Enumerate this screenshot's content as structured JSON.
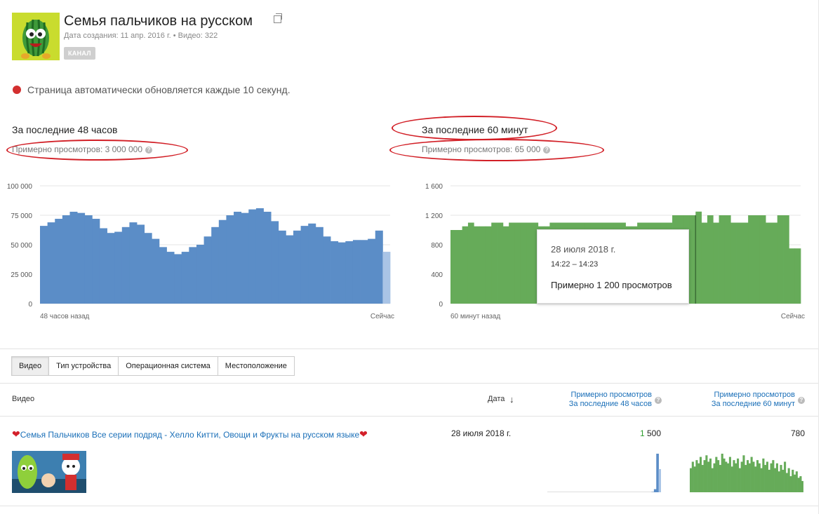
{
  "channel": {
    "title": "Семья пальчиков на русском",
    "meta": "Дата создания: 11 апр. 2016 г.  •  Видео: 322",
    "badge": "КАНАЛ"
  },
  "live_notice": "Страница автоматически обновляется каждые 10 секунд.",
  "sections": {
    "left": {
      "title": "За последние 48 часов",
      "views": "Примерно просмотров: 3 000 000",
      "start_label": "48 часов назад",
      "end_label": "Сейчас"
    },
    "right": {
      "title": "За последние 60 минут",
      "views": "Примерно просмотров: 65 000",
      "start_label": "60 минут назад",
      "end_label": "Сейчас"
    }
  },
  "tooltip": {
    "date": "28 июля 2018 г.",
    "time": "14:22 – 14:23",
    "views": "Примерно 1 200 просмотров"
  },
  "tabs": [
    "Видео",
    "Тип устройства",
    "Операционная система",
    "Местоположение"
  ],
  "table": {
    "headers": {
      "video": "Видео",
      "date": "Дата",
      "views48_line1": "Примерно просмотров",
      "views48_line2": "За последние 48 часов",
      "views60_line1": "Примерно просмотров",
      "views60_line2": "За последние 60 минут"
    },
    "rows": [
      {
        "title": "Семья Пальчиков Все серии подряд - Хелло Китти, Овощи и Фрукты на русском языке",
        "date": "28 июля 2018 г.",
        "views48_a": "1",
        "views48_b": " 500",
        "views60": "780"
      }
    ]
  },
  "colors": {
    "blue_bars": "#5b8dc7",
    "green_bars": "#66ab59",
    "annotation_red": "#d21f26",
    "link_blue": "#1a6fb8"
  },
  "chart_data": [
    {
      "type": "bar",
      "title": "За последние 48 часов",
      "ylim": [
        0,
        100000
      ],
      "yticks": [
        "100 000",
        "75 000",
        "50 000",
        "25 000",
        "0"
      ],
      "x_start_label": "48 часов назад",
      "x_end_label": "Сейчас",
      "values": [
        66000,
        69000,
        72000,
        75000,
        78000,
        77000,
        75000,
        72000,
        64000,
        60000,
        61000,
        65000,
        69000,
        67000,
        60000,
        55000,
        48000,
        44000,
        42000,
        44000,
        48000,
        50000,
        57000,
        65000,
        71000,
        75000,
        78000,
        77000,
        80000,
        81000,
        78000,
        70000,
        62000,
        58000,
        62000,
        66000,
        68000,
        65000,
        57000,
        53000,
        52000,
        53000,
        54000,
        54000,
        55000,
        62000,
        44000
      ]
    },
    {
      "type": "bar",
      "title": "За последние 60 минут",
      "ylim": [
        0,
        1600
      ],
      "yticks": [
        "1 600",
        "1 200",
        "800",
        "400",
        "0"
      ],
      "x_start_label": "60 минут назад",
      "x_end_label": "Сейчас",
      "values": [
        1000,
        1000,
        1050,
        1100,
        1050,
        1050,
        1050,
        1100,
        1100,
        1050,
        1100,
        1100,
        1100,
        1100,
        1100,
        1050,
        1050,
        1100,
        1100,
        1100,
        1100,
        1100,
        1100,
        1100,
        1100,
        1100,
        1100,
        1100,
        1100,
        1100,
        1050,
        1050,
        1100,
        1100,
        1100,
        1100,
        1100,
        1100,
        1200,
        1200,
        1200,
        1200,
        1250,
        1100,
        1200,
        1100,
        1200,
        1200,
        1100,
        1100,
        1100,
        1200,
        1200,
        1200,
        1100,
        1100,
        1200,
        1200,
        750,
        750
      ]
    }
  ]
}
